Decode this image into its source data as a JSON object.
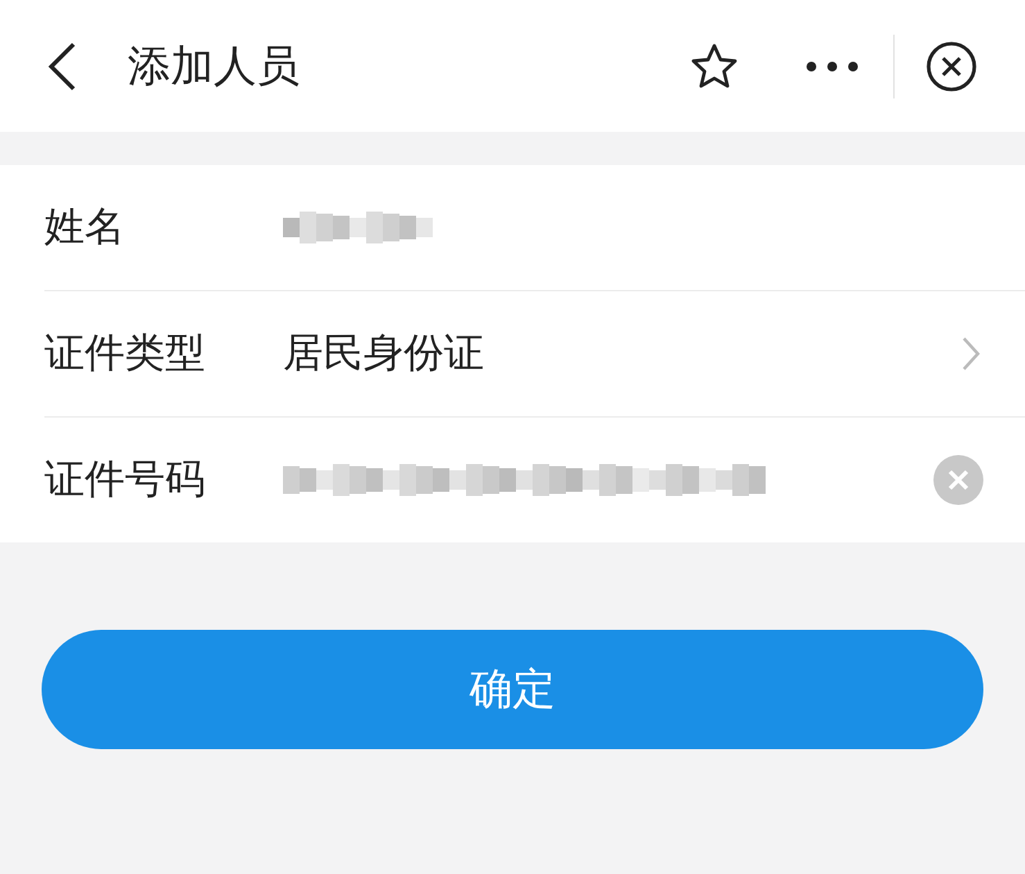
{
  "header": {
    "title": "添加人员"
  },
  "form": {
    "rows": [
      {
        "kind": "text",
        "label": "姓名",
        "redacted": true,
        "clearable": false
      },
      {
        "kind": "select",
        "label": "证件类型",
        "value": "居民身份证"
      },
      {
        "kind": "text",
        "label": "证件号码",
        "redacted": true,
        "clearable": true
      }
    ]
  },
  "confirm_button": {
    "label": "确定"
  }
}
